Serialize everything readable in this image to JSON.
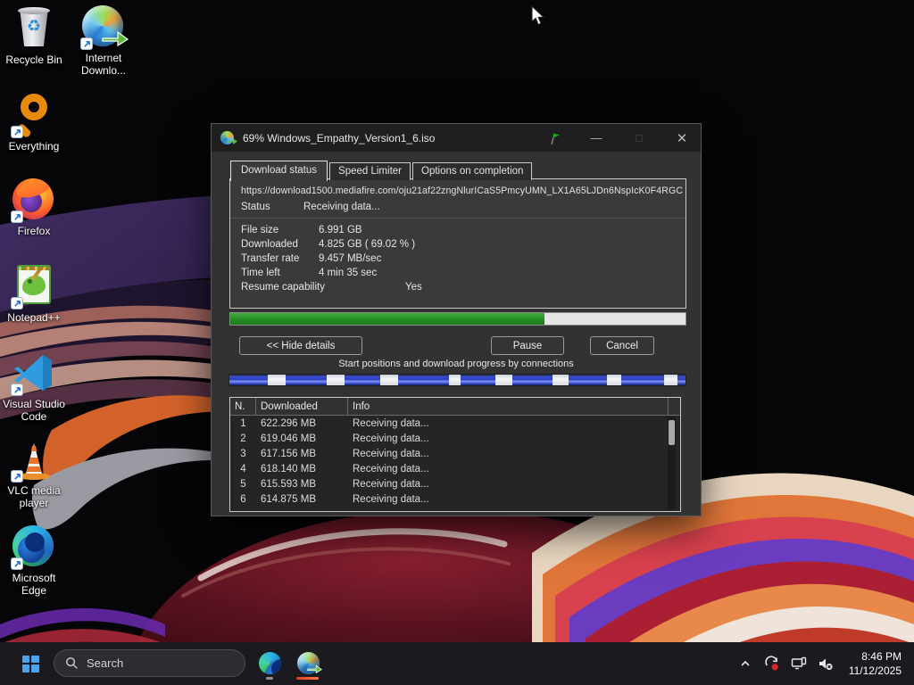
{
  "desktop": {
    "icons": [
      {
        "name": "recycle-bin",
        "label": "Recycle Bin"
      },
      {
        "name": "internet-download-manager",
        "label": "Internet Downlo..."
      },
      {
        "name": "everything",
        "label": "Everything"
      },
      {
        "name": "firefox",
        "label": "Firefox"
      },
      {
        "name": "notepad-plus-plus",
        "label": "Notepad++"
      },
      {
        "name": "visual-studio-code",
        "label": "Visual Studio Code"
      },
      {
        "name": "vlc-media-player",
        "label": "VLC media player"
      },
      {
        "name": "microsoft-edge",
        "label": "Microsoft Edge"
      }
    ]
  },
  "dialog": {
    "title": "69% Windows_Empathy_Version1_6.iso",
    "tabs": [
      {
        "label": "Download status",
        "active": true
      },
      {
        "label": "Speed Limiter",
        "active": false
      },
      {
        "label": "Options on completion",
        "active": false
      }
    ],
    "url": "https://download1500.mediafire.com/oju21af22zngNlurICaS5PmcyUMN_LX1A65LJDn6NspIcK0F4RGC",
    "status": {
      "label": "Status",
      "value": "Receiving data..."
    },
    "fields": [
      {
        "label": "File size",
        "value": "6.991 GB"
      },
      {
        "label": "Downloaded",
        "value": "4.825 GB ( 69.02 % )"
      },
      {
        "label": "Transfer rate",
        "value": "9.457 MB/sec"
      },
      {
        "label": "Time left",
        "value": "4 min 35 sec"
      },
      {
        "label": "Resume capability",
        "value": "Yes"
      }
    ],
    "progress_percent": 69,
    "buttons": {
      "hide_details": "<< Hide details",
      "pause": "Pause",
      "cancel": "Cancel"
    },
    "connections_caption": "Start positions and download progress by connections",
    "connections": {
      "bar_color": "#2b3abf",
      "gaps": [
        [
          8.4,
          3.9
        ],
        [
          21.4,
          3.9
        ],
        [
          33.1,
          3.9
        ],
        [
          48.1,
          2.6
        ],
        [
          58.3,
          3.7
        ],
        [
          70.8,
          3.5
        ],
        [
          82.7,
          3.3
        ],
        [
          95.4,
          2.9
        ]
      ]
    },
    "table": {
      "headers": [
        "N.",
        "Downloaded",
        "Info"
      ],
      "rows": [
        [
          "1",
          "622.296 MB",
          "Receiving data..."
        ],
        [
          "2",
          "619.046 MB",
          "Receiving data..."
        ],
        [
          "3",
          "617.156 MB",
          "Receiving data..."
        ],
        [
          "4",
          "618.140 MB",
          "Receiving data..."
        ],
        [
          "5",
          "615.593 MB",
          "Receiving data..."
        ],
        [
          "6",
          "614.875 MB",
          "Receiving data..."
        ]
      ]
    }
  },
  "taskbar": {
    "search_label": "Search",
    "clock": {
      "time": "8:46 PM",
      "date": "11/12/2025"
    }
  },
  "colors": {
    "progress_green": "#238a23",
    "connections_blue": "#2b3abf",
    "accent_blue": "#46a6f5",
    "idm_indicator": "#e8502a",
    "dialog_bg": "#323232",
    "titlebar_bg": "#1f1f1f",
    "taskbar_bg": "#1b1b1f"
  }
}
